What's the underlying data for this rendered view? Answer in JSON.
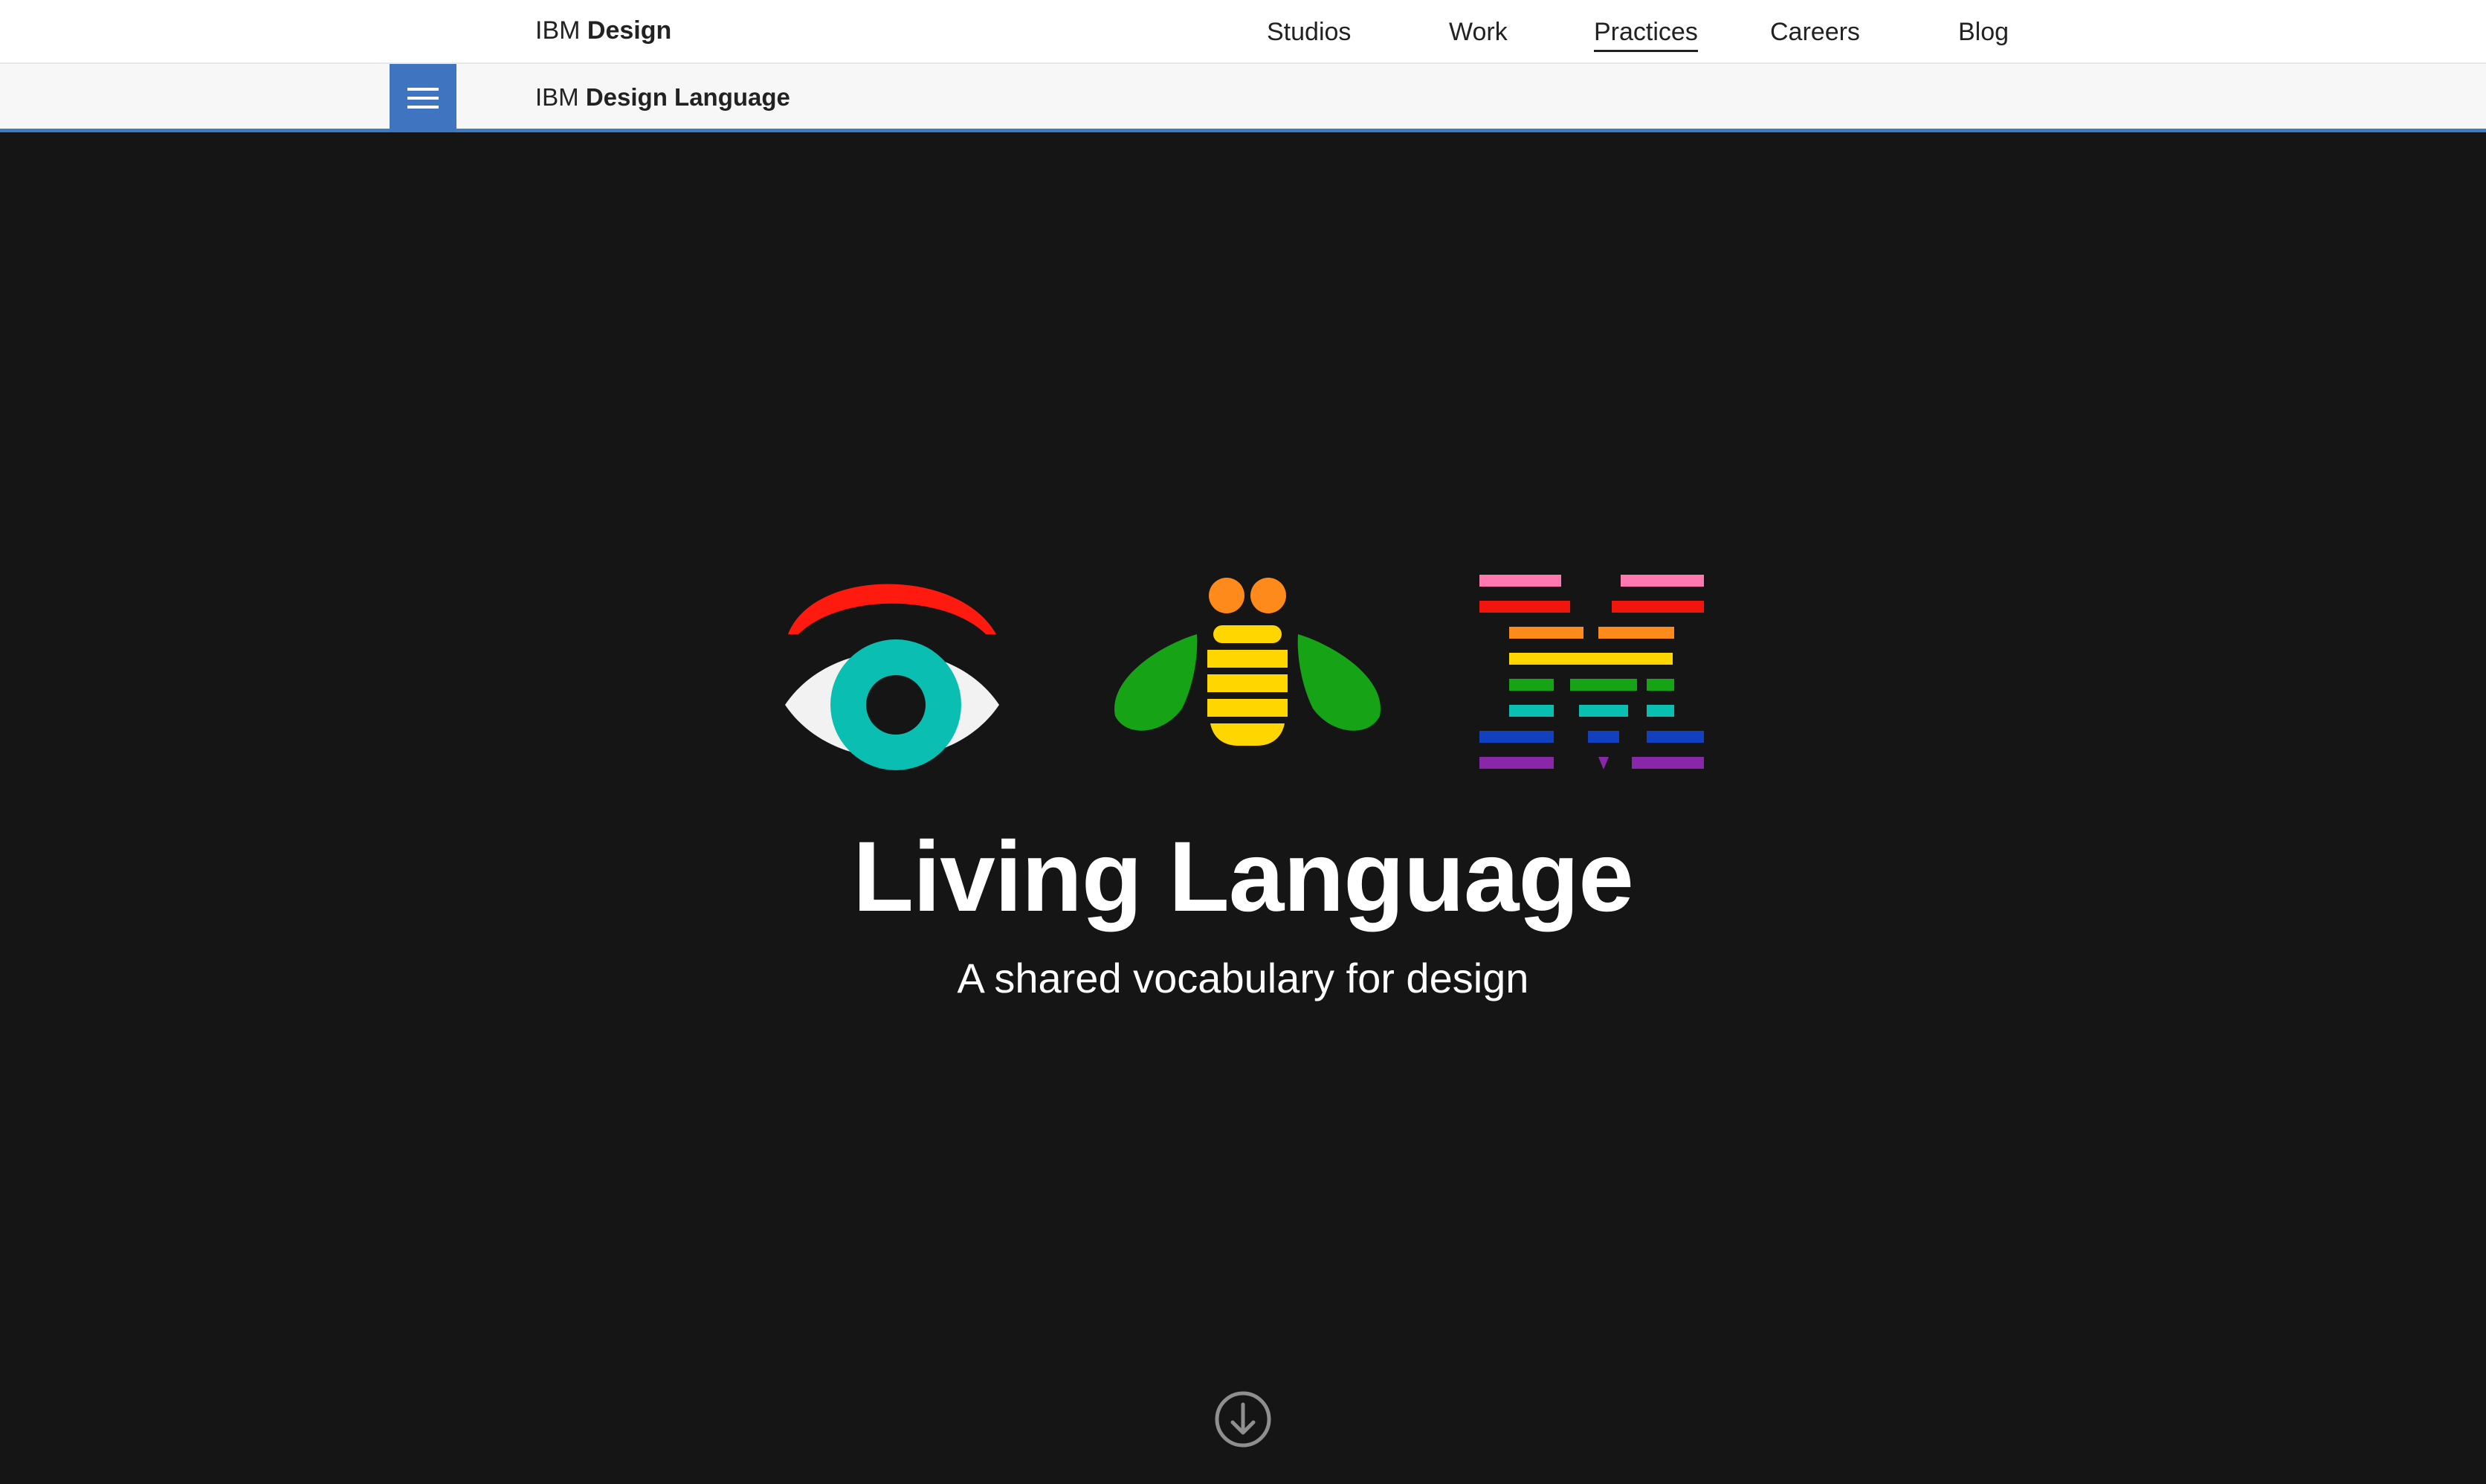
{
  "topnav": {
    "brand_prefix": "IBM",
    "brand_name": "Design",
    "links": [
      {
        "label": "Studios",
        "active": false
      },
      {
        "label": "Work",
        "active": false
      },
      {
        "label": "Practices",
        "active": true
      },
      {
        "label": "Careers",
        "active": false
      },
      {
        "label": "Blog",
        "active": false
      }
    ]
  },
  "subnav": {
    "menu_icon": "hamburger-menu-icon",
    "brand_prefix": "IBM",
    "brand_name": "Design Language"
  },
  "hero": {
    "title": "Living Language",
    "subtitle": "A shared vocabulary for design",
    "logo_icons": [
      "eye-icon",
      "bee-icon",
      "striped-m-icon"
    ],
    "scroll_icon": "arrow-down-circle-icon"
  },
  "colors": {
    "accent_blue": "#3f74c0",
    "hero_background": "#151515",
    "eye_brow": "#ff1a10",
    "eye_iris": "#0abfb2",
    "bee_body": "#ffd600",
    "bee_head": "#ff8a1c",
    "bee_wings": "#16a316",
    "m_stripes": [
      "#ff79b0",
      "#f0160e",
      "#ff8a1c",
      "#ffd600",
      "#16a316",
      "#0abfb2",
      "#1140c0",
      "#8a27a8"
    ]
  }
}
